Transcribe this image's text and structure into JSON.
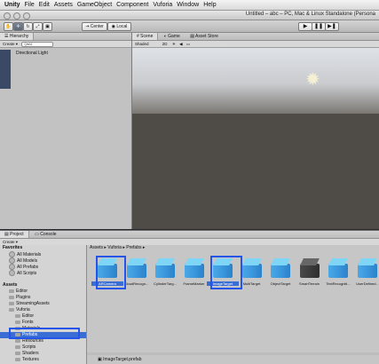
{
  "menubar": {
    "app": "Unity",
    "items": [
      "File",
      "Edit",
      "Assets",
      "GameObject",
      "Component",
      "Vuforia",
      "Window",
      "Help"
    ]
  },
  "window": {
    "title": "Untitled – abc – PC, Mac & Linux Standalone (Persona"
  },
  "toolbar": {
    "pivot_label": "Center",
    "space_label": "Local",
    "play": "▶",
    "pause": "❚❚",
    "step": "▶❚"
  },
  "hierarchy": {
    "tab": "Hierarchy",
    "create": "Create ▾",
    "search": "Q▾All",
    "items": [
      "Directional Light"
    ]
  },
  "scene": {
    "tabs": [
      "Scene",
      "Game",
      "Asset Store"
    ],
    "shading": "Shaded",
    "mode": "2D"
  },
  "project": {
    "tabs": [
      "Project",
      "Console"
    ],
    "create": "Create ▾",
    "breadcrumb": "Assets ▸ Vuforia ▸ Prefabs ▸",
    "tree": [
      {
        "label": "Favorites",
        "kind": "hdr",
        "indent": 0
      },
      {
        "label": "All Materials",
        "kind": "fav",
        "indent": 1
      },
      {
        "label": "All Models",
        "kind": "fav",
        "indent": 1
      },
      {
        "label": "All Prefabs",
        "kind": "fav",
        "indent": 1
      },
      {
        "label": "All Scripts",
        "kind": "fav",
        "indent": 1
      },
      {
        "label": "",
        "kind": "gap",
        "indent": 0
      },
      {
        "label": "Assets",
        "kind": "hdr",
        "indent": 0
      },
      {
        "label": "Editor",
        "kind": "folder",
        "indent": 1
      },
      {
        "label": "Plugins",
        "kind": "folder",
        "indent": 1
      },
      {
        "label": "StreamingAssets",
        "kind": "folder",
        "indent": 1
      },
      {
        "label": "Vuforia",
        "kind": "folder",
        "indent": 1
      },
      {
        "label": "Editor",
        "kind": "folder",
        "indent": 2
      },
      {
        "label": "Fonts",
        "kind": "folder",
        "indent": 2
      },
      {
        "label": "Materials",
        "kind": "folder",
        "indent": 2
      },
      {
        "label": "Prefabs",
        "kind": "folder-sel",
        "indent": 2
      },
      {
        "label": "Resources",
        "kind": "folder",
        "indent": 2
      },
      {
        "label": "Scripts",
        "kind": "folder",
        "indent": 2
      },
      {
        "label": "Shaders",
        "kind": "folder",
        "indent": 2
      },
      {
        "label": "Textures",
        "kind": "folder",
        "indent": 2
      }
    ],
    "assets": [
      {
        "label": "ARCamera",
        "dark": false,
        "selected": true
      },
      {
        "label": "CloudRecogn...",
        "dark": false,
        "selected": false
      },
      {
        "label": "CylinderTarg...",
        "dark": false,
        "selected": false
      },
      {
        "label": "FrameMarker",
        "dark": false,
        "selected": false
      },
      {
        "label": "ImageTarget",
        "dark": false,
        "selected": true
      },
      {
        "label": "MultiTarget",
        "dark": false,
        "selected": false
      },
      {
        "label": "ObjectTarget",
        "dark": false,
        "selected": false
      },
      {
        "label": "SmartTerrain",
        "dark": true,
        "selected": false
      },
      {
        "label": "TextRecogniti...",
        "dark": false,
        "selected": false
      },
      {
        "label": "UserDefined..",
        "dark": false,
        "selected": false
      }
    ],
    "status": "ImageTarget.prefab"
  }
}
